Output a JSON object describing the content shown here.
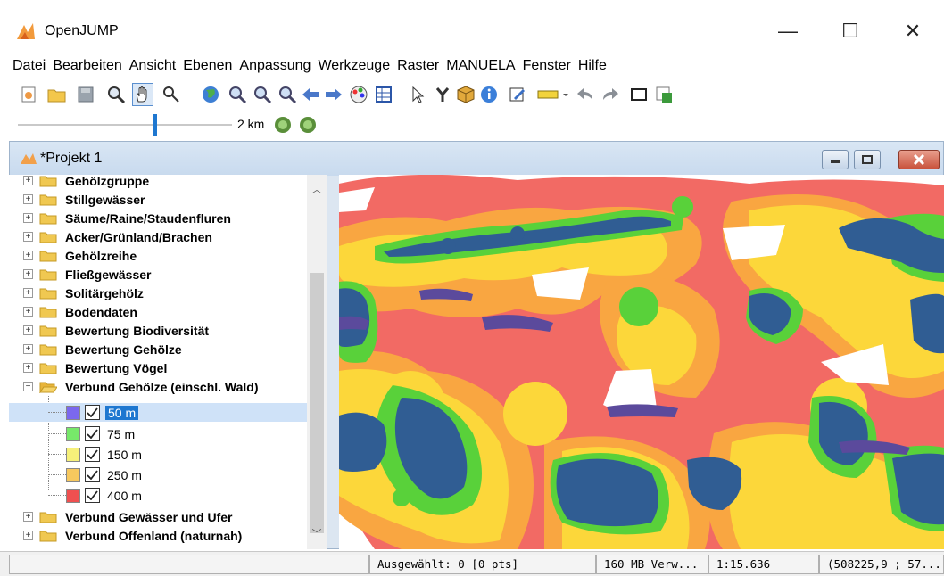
{
  "app": {
    "title": "OpenJUMP"
  },
  "window_controls": {
    "minimize": "—",
    "maximize": "☐",
    "close": "✕"
  },
  "menu": [
    "Datei",
    "Bearbeiten",
    "Ansicht",
    "Ebenen",
    "Anpassung",
    "Werkzeuge",
    "Raster",
    "MANUELA",
    "Fenster",
    "Hilfe"
  ],
  "toolbar": {
    "icons": [
      "new-project-icon",
      "open-folder-icon",
      "save-icon",
      "zoom-icon",
      "pan-hand-icon",
      "zoom-tool-icon",
      "globe-icon",
      "zoom-extent-icon",
      "zoom-previous-icon",
      "zoom-next-icon",
      "back-arrow-icon",
      "forward-arrow-icon",
      "style-palette-icon",
      "attribute-table-icon",
      "select-pointer-icon",
      "move-tool-icon",
      "package-icon",
      "info-icon",
      "edit-icon",
      "measure-ruler-icon",
      "undo-icon",
      "redo-icon",
      "frame-icon",
      "plugin-icon"
    ]
  },
  "zoom": {
    "scale_label": "2 km",
    "level": 0.63
  },
  "project": {
    "title": "*Projekt 1"
  },
  "tree": {
    "categories_top": [
      "Gehölzgruppe",
      "Stillgewässer",
      "Säume/Raine/Staudenfluren",
      "Acker/Grünland/Brachen",
      "Gehölzreihe",
      "Fließgewässer",
      "Solitärgehölz",
      "Bodendaten",
      "Bewertung Biodiversität",
      "Bewertung Gehölze",
      "Bewertung Vögel"
    ],
    "expanded": "Verbund Gehölze (einschl. Wald)",
    "layers": [
      {
        "label": "50 m",
        "color": "#7b68ee",
        "checked": true,
        "selected": true
      },
      {
        "label": "75 m",
        "color": "#77e86a",
        "checked": true,
        "selected": false
      },
      {
        "label": "150 m",
        "color": "#f6f07a",
        "checked": true,
        "selected": false
      },
      {
        "label": "250 m",
        "color": "#f7c85e",
        "checked": true,
        "selected": false
      },
      {
        "label": "400 m",
        "color": "#ef5050",
        "checked": true,
        "selected": false
      }
    ],
    "categories_bottom": [
      "Verbund Gewässer und Ufer",
      "Verbund Offenland (naturnah)"
    ]
  },
  "status": {
    "selected": "Ausgewählt: 0 [0 pts]",
    "memory": "160 MB Verw...",
    "scale": "1:15.636",
    "coords": "(508225,9 ; 57..."
  },
  "map_colors": {
    "red": "#f26a64",
    "orange": "#f9a641",
    "yellow": "#fcd73a",
    "green": "#59d13a",
    "blue": "#305d93",
    "purple": "#5b4a9c"
  }
}
